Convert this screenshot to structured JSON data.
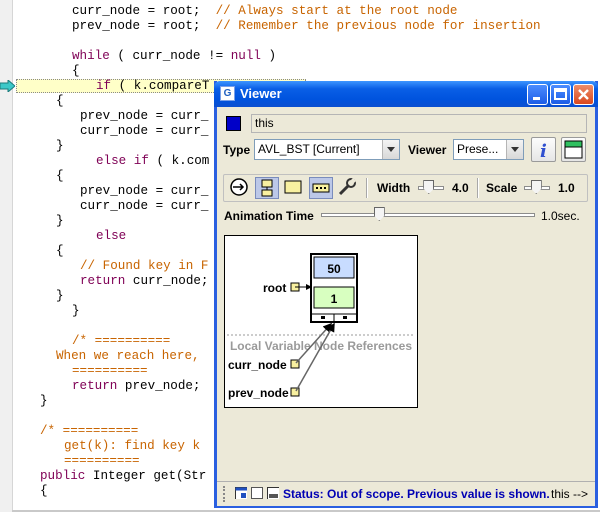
{
  "editor": {
    "lines": [
      [
        {
          "t": "curr_node = root;  "
        },
        {
          "t": "// Always start at the root node",
          "c": "cm"
        }
      ],
      [
        {
          "t": "prev_node = root;  "
        },
        {
          "t": "// Remember the previous node for insertion",
          "c": "cm"
        }
      ],
      [
        {
          "t": ""
        }
      ],
      [
        {
          "t": "while",
          "c": "kw"
        },
        {
          "t": " ( curr_node != "
        },
        {
          "t": "null",
          "c": "kw"
        },
        {
          "t": " )"
        }
      ],
      [
        {
          "t": "{"
        }
      ],
      [
        {
          "t": "if",
          "c": "kw"
        },
        {
          "t": " ( k.compareT"
        }
      ],
      [
        {
          "t": "{"
        }
      ],
      [
        {
          "t": "prev_node = curr_"
        }
      ],
      [
        {
          "t": "curr_node = curr_"
        }
      ],
      [
        {
          "t": "}"
        }
      ],
      [
        {
          "t": "else if",
          "c": "kw"
        },
        {
          "t": " ( k.com"
        }
      ],
      [
        {
          "t": "{"
        }
      ],
      [
        {
          "t": "prev_node = curr_"
        }
      ],
      [
        {
          "t": "curr_node = curr_"
        }
      ],
      [
        {
          "t": "}"
        }
      ],
      [
        {
          "t": "else",
          "c": "kw"
        }
      ],
      [
        {
          "t": "{"
        }
      ],
      [
        {
          "t": "// Found key in F",
          "c": "cm"
        }
      ],
      [
        {
          "t": "return",
          "c": "kw"
        },
        {
          "t": " curr_node;"
        }
      ],
      [
        {
          "t": "}"
        }
      ],
      [
        {
          "t": "}"
        }
      ],
      [
        {
          "t": ""
        }
      ],
      [
        {
          "t": "/* ==========",
          "c": "cm"
        }
      ],
      [
        {
          "t": "When we reach here,",
          "c": "cm"
        }
      ],
      [
        {
          "t": "==========",
          "c": "cm"
        }
      ],
      [
        {
          "t": "return",
          "c": "kw"
        },
        {
          "t": " prev_node;"
        }
      ],
      [
        {
          "t": "}"
        }
      ],
      [
        {
          "t": ""
        }
      ],
      [
        {
          "t": "/* ==========",
          "c": "cm"
        }
      ],
      [
        {
          "t": "get(k): find key k",
          "c": "cm"
        }
      ],
      [
        {
          "t": "==========",
          "c": "cm"
        }
      ],
      [
        {
          "t": "public",
          "c": "kw"
        },
        {
          "t": " Integer get(Str"
        }
      ],
      [
        {
          "t": "{"
        }
      ]
    ]
  },
  "viewer": {
    "title": "Viewer",
    "icon_glyph": "G",
    "colors": {
      "swatch": "#0000c8",
      "title_bar": "#0053de",
      "status_text": "#0000b4"
    },
    "variable_name": "this",
    "type_label": "Type",
    "type_value": "AVL_BST  [Current]",
    "viewer_label": "Viewer",
    "viewer_value": "Prese...",
    "width_label": "Width",
    "width_value": "4.0",
    "scale_label": "Scale",
    "scale_value": "1.0",
    "animation_label": "Animation Time",
    "animation_value": "1.0sec.",
    "animation_fraction": 0.26,
    "width_fraction": 0.35,
    "scale_fraction": 0.45,
    "canvas": {
      "node_key": "50",
      "node_height": "1",
      "root_label": "root",
      "section_title": "Local Variable Node References",
      "ref1_label": "curr_node",
      "ref2_label": "prev_node"
    },
    "status_text": "Status: Out of scope. Previous value is shown.",
    "status_link": "this -->"
  }
}
